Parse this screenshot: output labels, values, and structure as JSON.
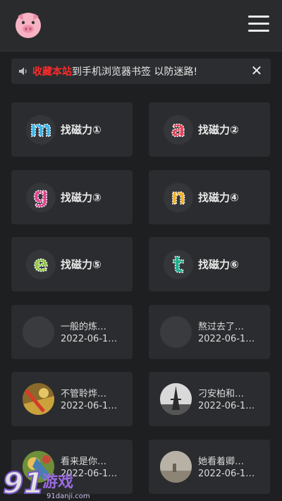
{
  "header": {
    "logo_icon": "pig-face-icon",
    "menu_icon": "hamburger-menu-icon"
  },
  "notice": {
    "speaker_icon": "speaker-icon",
    "highlight": "收藏本站",
    "text": "到手机浏览器书签 以防迷路!",
    "close_label": "✕",
    "highlight_color": "#ff2a2a"
  },
  "links": [
    {
      "letter": "m",
      "label": "找磁力①",
      "color": "#3bb3e8"
    },
    {
      "letter": "a",
      "label": "找磁力②",
      "color": "#e8455a"
    },
    {
      "letter": "g",
      "label": "找磁力③",
      "color": "#e0428f"
    },
    {
      "letter": "n",
      "label": "找磁力④",
      "color": "#f2b21b"
    },
    {
      "letter": "e",
      "label": "找磁力⑤",
      "color": "#8cc63f"
    },
    {
      "letter": "t",
      "label": "找磁力⑥",
      "color": "#1fae8c"
    }
  ],
  "posts": [
    {
      "title": "一般的炼…",
      "date": "2022-06-1…"
    },
    {
      "title": "熬过去了…",
      "date": "2022-06-1…"
    },
    {
      "title": "不管聆烨…",
      "date": "2022-06-1…"
    },
    {
      "title": "刁安柏和…",
      "date": "2022-06-1…"
    },
    {
      "title": "看来是你…",
      "date": "2022-06-1…"
    },
    {
      "title": "她看着卿…",
      "date": "2022-06-1…"
    }
  ],
  "watermark": {
    "number": "91",
    "text": "游戏",
    "url": "91danji.com"
  }
}
